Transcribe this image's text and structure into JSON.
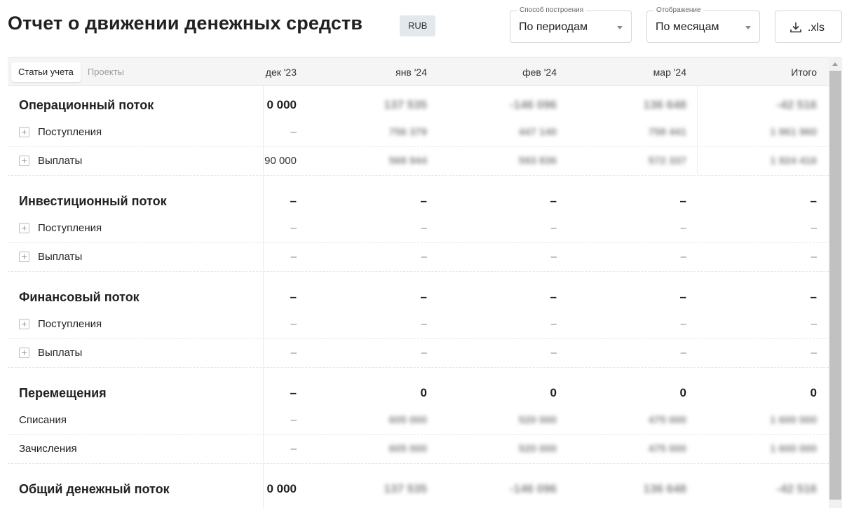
{
  "header": {
    "title": "Отчет о движении денежных средств",
    "currency_badge": "RUB"
  },
  "controls": {
    "method": {
      "legend": "Способ построения",
      "value": "По периодам"
    },
    "display": {
      "legend": "Отображение",
      "value": "По месяцам"
    },
    "export": {
      "label": ".xls",
      "icon": "download-icon"
    }
  },
  "table": {
    "tabs": [
      {
        "label": "Статьи учета",
        "active": true
      },
      {
        "label": "Проекты",
        "active": false
      }
    ],
    "columns": [
      "дек '23",
      "янв '24",
      "фев '24",
      "мар '24",
      "Итого"
    ],
    "sections": [
      {
        "name": "Операционный поток",
        "values": [
          "0 000",
          "137 535",
          "-146 096",
          "136 648",
          "-42 516"
        ],
        "rows": [
          {
            "label": "Поступления",
            "expandable": true,
            "values": [
              "–",
              "756 379",
              "447 140",
              "758 441",
              "1 961 960"
            ]
          },
          {
            "label": "Выплаты",
            "expandable": true,
            "values": [
              "90 000",
              "568 944",
              "593 836",
              "572 337",
              "1 924 416"
            ]
          }
        ]
      },
      {
        "name": "Инвестиционный поток",
        "values": [
          "–",
          "–",
          "–",
          "–",
          "–"
        ],
        "rows": [
          {
            "label": "Поступления",
            "expandable": true,
            "values": [
              "–",
              "–",
              "–",
              "–",
              "–"
            ]
          },
          {
            "label": "Выплаты",
            "expandable": true,
            "values": [
              "–",
              "–",
              "–",
              "–",
              "–"
            ]
          }
        ]
      },
      {
        "name": "Финансовый поток",
        "values": [
          "–",
          "–",
          "–",
          "–",
          "–"
        ],
        "rows": [
          {
            "label": "Поступления",
            "expandable": true,
            "values": [
              "–",
              "–",
              "–",
              "–",
              "–"
            ]
          },
          {
            "label": "Выплаты",
            "expandable": true,
            "values": [
              "–",
              "–",
              "–",
              "–",
              "–"
            ]
          }
        ]
      },
      {
        "name": "Перемещения",
        "values": [
          "–",
          "0",
          "0",
          "0",
          "0"
        ],
        "rows": [
          {
            "label": "Списания",
            "expandable": false,
            "values": [
              "–",
              "605 000",
              "520 000",
              "475 000",
              "1 600 000"
            ]
          },
          {
            "label": "Зачисления",
            "expandable": false,
            "values": [
              "–",
              "605 000",
              "520 000",
              "475 000",
              "1 600 000"
            ]
          }
        ]
      }
    ],
    "total": {
      "name": "Общий денежный поток",
      "values": [
        "0 000",
        "137 535",
        "-146 096",
        "136 648",
        "-42 516"
      ]
    }
  }
}
